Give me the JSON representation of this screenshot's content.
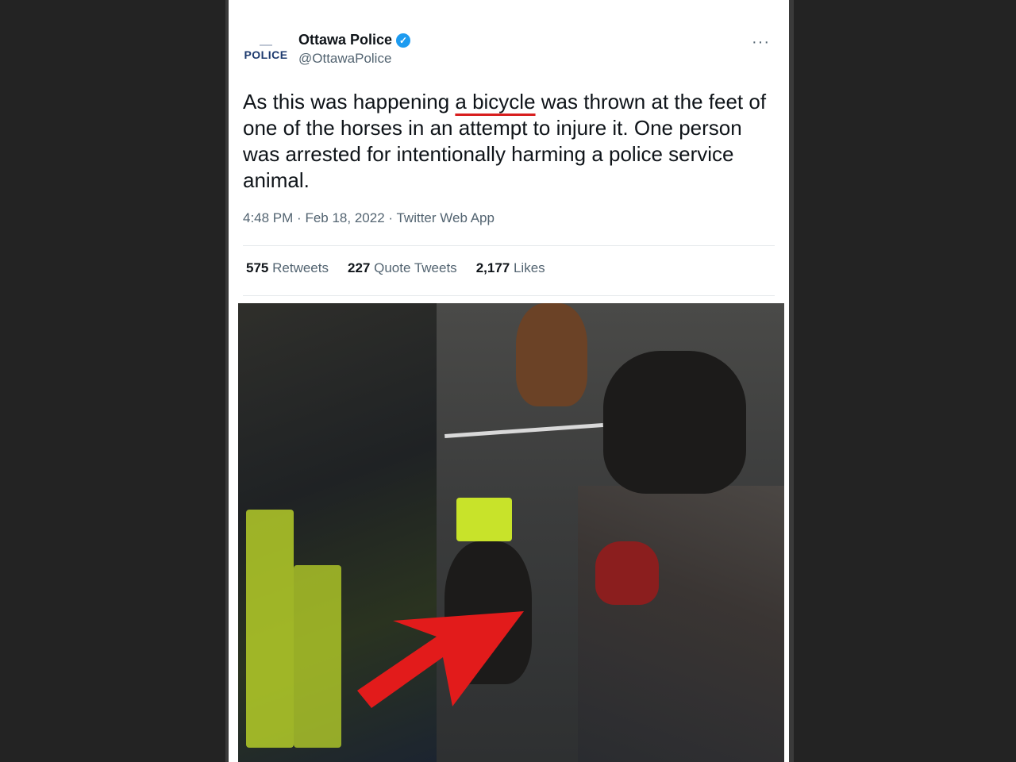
{
  "tweet": {
    "author": {
      "avatar_text": "POLICE",
      "display_name": "Ottawa Police",
      "handle": "@OttawaPolice",
      "verified_icon": "check-badge-icon"
    },
    "more_icon": "ellipsis-icon",
    "text_before": "As this was happening ",
    "text_highlight": "a bicycle",
    "text_after": " was thrown at the feet of one of the horses in an attempt to injure it. One person was arrested for intentionally harming a police service animal.",
    "time": "4:48 PM",
    "date": "Feb 18, 2022",
    "source": "Twitter Web App",
    "separator": "·",
    "stats": {
      "retweets_count": "575",
      "retweets_label": "Retweets",
      "quotes_count": "227",
      "quotes_label": "Quote Tweets",
      "likes_count": "2,177",
      "likes_label": "Likes"
    },
    "colors": {
      "verified": "#1d9bf0",
      "highlight_underline": "#d81e1e",
      "arrow": "#e21b1b"
    }
  }
}
